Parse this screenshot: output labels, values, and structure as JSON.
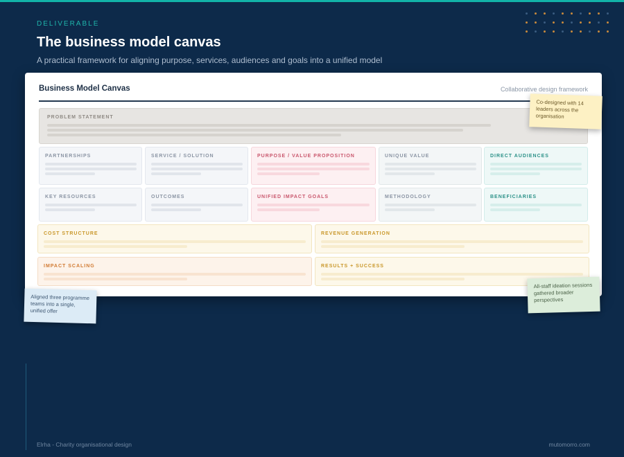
{
  "header": {
    "eyebrow": "DELIVERABLE",
    "title": "The business model canvas",
    "subtitle": "A practical framework for aligning purpose, services, audiences and goals into a unified model"
  },
  "canvas": {
    "title": "Business Model Canvas",
    "subtitle": "Collaborative design framework",
    "blocks": {
      "problem_statement": "PROBLEM STATEMENT",
      "partnerships": "PARTNERSHIPS",
      "service_solution": "SERVICE / SOLUTION",
      "purpose_value": "PURPOSE / VALUE PROPOSITION",
      "unique_value": "UNIQUE VALUE",
      "direct_audiences": "DIRECT AUDIENCES",
      "key_resources": "KEY RESOURCES",
      "outcomes": "OUTCOMES",
      "unified_impact_goals": "UNIFIED IMPACT GOALS",
      "methodology": "METHODOLOGY",
      "beneficiaries": "BENEFICIARIES",
      "cost_structure": "COST STRUCTURE",
      "revenue_generation": "REVENUE GENERATION",
      "impact_scaling": "IMPACT SCALING",
      "results_success": "RESULTS + SUCCESS"
    }
  },
  "notes": {
    "yellow": "Co-designed with 14 leaders across the organisation",
    "blue": "Aligned three programme teams into a single, unified offer",
    "green": "All-staff ideation sessions gathered broader perspectives"
  },
  "footer": {
    "left": "Elrha - Charity organisational design",
    "right": "mutomorro.com"
  },
  "colors": {
    "background": "#0d2a4a",
    "accent_teal": "#12b3a8",
    "dot_orange": "#c98a3c",
    "dot_blue": "#3a5c80"
  }
}
